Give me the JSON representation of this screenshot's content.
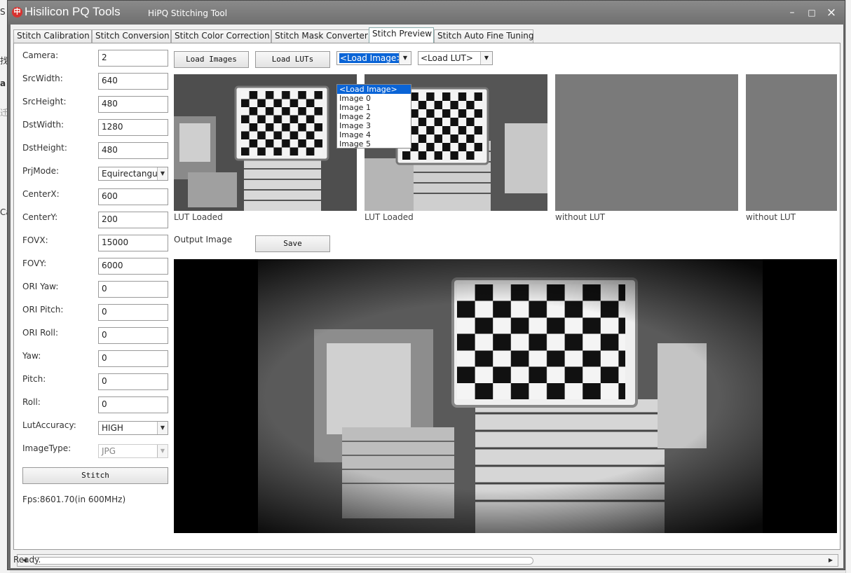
{
  "window": {
    "app_name": "Hisilicon PQ Tools",
    "title": "HiPQ Stitching Tool",
    "minimize": "–",
    "maximize": "□",
    "close": "×"
  },
  "tabs": [
    {
      "label": "Stitch Calibration"
    },
    {
      "label": "Stitch Conversion"
    },
    {
      "label": "Stitch Color Correction"
    },
    {
      "label": "Stitch Mask Converter"
    },
    {
      "label": "Stitch Preview"
    },
    {
      "label": "Stitch Auto Fine Tuning"
    }
  ],
  "active_tab": "Stitch Preview",
  "params": {
    "camera": {
      "label": "Camera:",
      "value": "2"
    },
    "src_width": {
      "label": "SrcWidth:",
      "value": "640"
    },
    "src_height": {
      "label": "SrcHeight:",
      "value": "480"
    },
    "dst_width": {
      "label": "DstWidth:",
      "value": "1280"
    },
    "dst_height": {
      "label": "DstHeight:",
      "value": "480"
    },
    "prj_mode": {
      "label": "PrjMode:",
      "value": "Equirectangul"
    },
    "center_x": {
      "label": "CenterX:",
      "value": "600"
    },
    "center_y": {
      "label": "CenterY:",
      "value": "200"
    },
    "fovx": {
      "label": "FOVX:",
      "value": "15000"
    },
    "fovy": {
      "label": "FOVY:",
      "value": "6000"
    },
    "ori_yaw": {
      "label": "ORI Yaw:",
      "value": "0"
    },
    "ori_pitch": {
      "label": "ORI Pitch:",
      "value": "0"
    },
    "ori_roll": {
      "label": "ORI Roll:",
      "value": "0"
    },
    "yaw": {
      "label": "Yaw:",
      "value": "0"
    },
    "pitch": {
      "label": "Pitch:",
      "value": "0"
    },
    "roll": {
      "label": "Roll:",
      "value": "0"
    },
    "lut_accuracy": {
      "label": "LutAccuracy:",
      "value": "HIGH"
    },
    "image_type": {
      "label": "ImageType:",
      "value": "JPG"
    }
  },
  "stitch_button": "Stitch",
  "fps_text": "Fps:8601.70(in 600MHz)",
  "toolbar": {
    "load_images": "Load Images",
    "load_luts": "Load LUTs",
    "image_combo": "<Load Image>",
    "lut_combo": "<Load LUT>",
    "save": "Save"
  },
  "image_dropdown": [
    "<Load Image>",
    "Image 0",
    "Image 1",
    "Image 2",
    "Image 3",
    "Image 4",
    "Image 5"
  ],
  "thumbnails": [
    {
      "caption": "LUT Loaded"
    },
    {
      "caption": "LUT Loaded"
    },
    {
      "caption": "without LUT"
    },
    {
      "caption": "without LUT"
    }
  ],
  "output_label": "Output Image",
  "status": "Ready.",
  "bg_fragments": [
    "S",
    "找",
    "a",
    "迁",
    "Ca"
  ],
  "colors": {
    "accent": "#0a64d6",
    "titlebar": "#7a7a7a"
  }
}
